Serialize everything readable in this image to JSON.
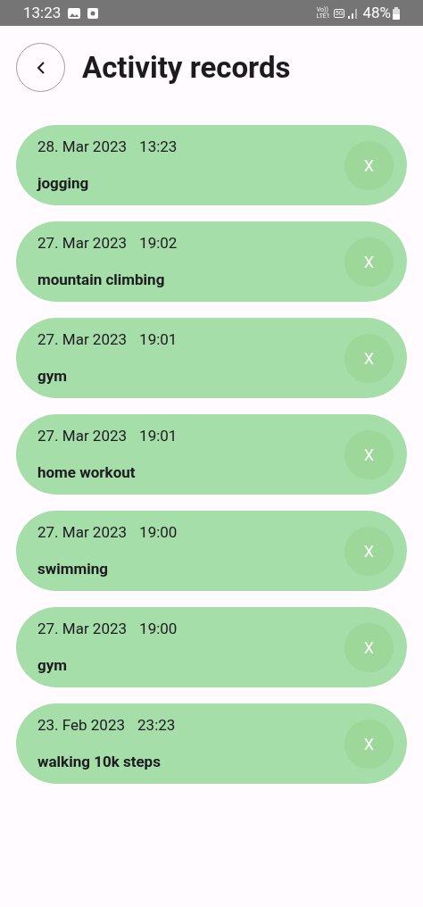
{
  "status_bar": {
    "time": "13:23",
    "network": [
      "Vo))",
      "LTE1"
    ],
    "network_type": "5G",
    "battery": "48%"
  },
  "header": {
    "title": "Activity records"
  },
  "records": [
    {
      "date": "28. Mar 2023",
      "time": "13:23",
      "activity": "jogging",
      "delete_label": "X"
    },
    {
      "date": "27. Mar 2023",
      "time": "19:02",
      "activity": "mountain climbing",
      "delete_label": "X"
    },
    {
      "date": "27. Mar 2023",
      "time": "19:01",
      "activity": "gym",
      "delete_label": "X"
    },
    {
      "date": "27. Mar 2023",
      "time": "19:01",
      "activity": "home workout",
      "delete_label": "X"
    },
    {
      "date": "27. Mar 2023",
      "time": "19:00",
      "activity": "swimming",
      "delete_label": "X"
    },
    {
      "date": "27. Mar 2023",
      "time": "19:00",
      "activity": "gym",
      "delete_label": "X"
    },
    {
      "date": "23. Feb 2023",
      "time": "23:23",
      "activity": "walking 10k steps",
      "delete_label": "X"
    }
  ]
}
